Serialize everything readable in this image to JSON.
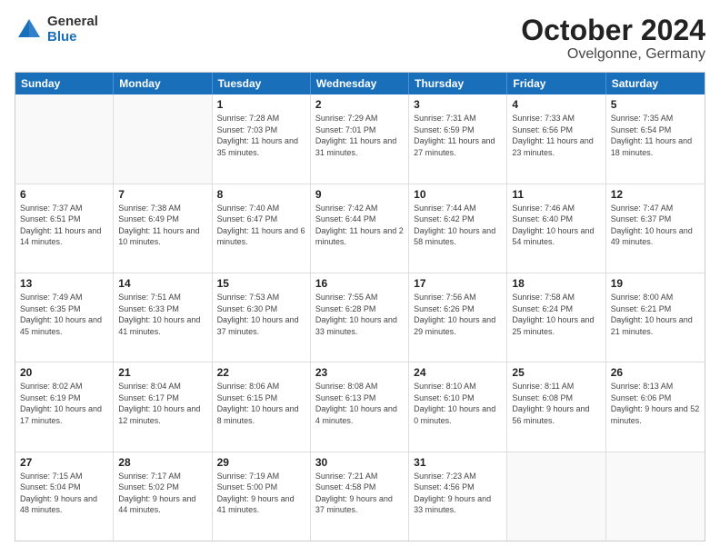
{
  "header": {
    "logo": {
      "general": "General",
      "blue": "Blue"
    },
    "title": "October 2024",
    "location": "Ovelgonne, Germany"
  },
  "weekdays": [
    "Sunday",
    "Monday",
    "Tuesday",
    "Wednesday",
    "Thursday",
    "Friday",
    "Saturday"
  ],
  "weeks": [
    [
      {
        "day": "",
        "sunrise": "",
        "sunset": "",
        "daylight": "",
        "empty": true
      },
      {
        "day": "",
        "sunrise": "",
        "sunset": "",
        "daylight": "",
        "empty": true
      },
      {
        "day": "1",
        "sunrise": "Sunrise: 7:28 AM",
        "sunset": "Sunset: 7:03 PM",
        "daylight": "Daylight: 11 hours and 35 minutes.",
        "empty": false
      },
      {
        "day": "2",
        "sunrise": "Sunrise: 7:29 AM",
        "sunset": "Sunset: 7:01 PM",
        "daylight": "Daylight: 11 hours and 31 minutes.",
        "empty": false
      },
      {
        "day": "3",
        "sunrise": "Sunrise: 7:31 AM",
        "sunset": "Sunset: 6:59 PM",
        "daylight": "Daylight: 11 hours and 27 minutes.",
        "empty": false
      },
      {
        "day": "4",
        "sunrise": "Sunrise: 7:33 AM",
        "sunset": "Sunset: 6:56 PM",
        "daylight": "Daylight: 11 hours and 23 minutes.",
        "empty": false
      },
      {
        "day": "5",
        "sunrise": "Sunrise: 7:35 AM",
        "sunset": "Sunset: 6:54 PM",
        "daylight": "Daylight: 11 hours and 18 minutes.",
        "empty": false
      }
    ],
    [
      {
        "day": "6",
        "sunrise": "Sunrise: 7:37 AM",
        "sunset": "Sunset: 6:51 PM",
        "daylight": "Daylight: 11 hours and 14 minutes.",
        "empty": false
      },
      {
        "day": "7",
        "sunrise": "Sunrise: 7:38 AM",
        "sunset": "Sunset: 6:49 PM",
        "daylight": "Daylight: 11 hours and 10 minutes.",
        "empty": false
      },
      {
        "day": "8",
        "sunrise": "Sunrise: 7:40 AM",
        "sunset": "Sunset: 6:47 PM",
        "daylight": "Daylight: 11 hours and 6 minutes.",
        "empty": false
      },
      {
        "day": "9",
        "sunrise": "Sunrise: 7:42 AM",
        "sunset": "Sunset: 6:44 PM",
        "daylight": "Daylight: 11 hours and 2 minutes.",
        "empty": false
      },
      {
        "day": "10",
        "sunrise": "Sunrise: 7:44 AM",
        "sunset": "Sunset: 6:42 PM",
        "daylight": "Daylight: 10 hours and 58 minutes.",
        "empty": false
      },
      {
        "day": "11",
        "sunrise": "Sunrise: 7:46 AM",
        "sunset": "Sunset: 6:40 PM",
        "daylight": "Daylight: 10 hours and 54 minutes.",
        "empty": false
      },
      {
        "day": "12",
        "sunrise": "Sunrise: 7:47 AM",
        "sunset": "Sunset: 6:37 PM",
        "daylight": "Daylight: 10 hours and 49 minutes.",
        "empty": false
      }
    ],
    [
      {
        "day": "13",
        "sunrise": "Sunrise: 7:49 AM",
        "sunset": "Sunset: 6:35 PM",
        "daylight": "Daylight: 10 hours and 45 minutes.",
        "empty": false
      },
      {
        "day": "14",
        "sunrise": "Sunrise: 7:51 AM",
        "sunset": "Sunset: 6:33 PM",
        "daylight": "Daylight: 10 hours and 41 minutes.",
        "empty": false
      },
      {
        "day": "15",
        "sunrise": "Sunrise: 7:53 AM",
        "sunset": "Sunset: 6:30 PM",
        "daylight": "Daylight: 10 hours and 37 minutes.",
        "empty": false
      },
      {
        "day": "16",
        "sunrise": "Sunrise: 7:55 AM",
        "sunset": "Sunset: 6:28 PM",
        "daylight": "Daylight: 10 hours and 33 minutes.",
        "empty": false
      },
      {
        "day": "17",
        "sunrise": "Sunrise: 7:56 AM",
        "sunset": "Sunset: 6:26 PM",
        "daylight": "Daylight: 10 hours and 29 minutes.",
        "empty": false
      },
      {
        "day": "18",
        "sunrise": "Sunrise: 7:58 AM",
        "sunset": "Sunset: 6:24 PM",
        "daylight": "Daylight: 10 hours and 25 minutes.",
        "empty": false
      },
      {
        "day": "19",
        "sunrise": "Sunrise: 8:00 AM",
        "sunset": "Sunset: 6:21 PM",
        "daylight": "Daylight: 10 hours and 21 minutes.",
        "empty": false
      }
    ],
    [
      {
        "day": "20",
        "sunrise": "Sunrise: 8:02 AM",
        "sunset": "Sunset: 6:19 PM",
        "daylight": "Daylight: 10 hours and 17 minutes.",
        "empty": false
      },
      {
        "day": "21",
        "sunrise": "Sunrise: 8:04 AM",
        "sunset": "Sunset: 6:17 PM",
        "daylight": "Daylight: 10 hours and 12 minutes.",
        "empty": false
      },
      {
        "day": "22",
        "sunrise": "Sunrise: 8:06 AM",
        "sunset": "Sunset: 6:15 PM",
        "daylight": "Daylight: 10 hours and 8 minutes.",
        "empty": false
      },
      {
        "day": "23",
        "sunrise": "Sunrise: 8:08 AM",
        "sunset": "Sunset: 6:13 PM",
        "daylight": "Daylight: 10 hours and 4 minutes.",
        "empty": false
      },
      {
        "day": "24",
        "sunrise": "Sunrise: 8:10 AM",
        "sunset": "Sunset: 6:10 PM",
        "daylight": "Daylight: 10 hours and 0 minutes.",
        "empty": false
      },
      {
        "day": "25",
        "sunrise": "Sunrise: 8:11 AM",
        "sunset": "Sunset: 6:08 PM",
        "daylight": "Daylight: 9 hours and 56 minutes.",
        "empty": false
      },
      {
        "day": "26",
        "sunrise": "Sunrise: 8:13 AM",
        "sunset": "Sunset: 6:06 PM",
        "daylight": "Daylight: 9 hours and 52 minutes.",
        "empty": false
      }
    ],
    [
      {
        "day": "27",
        "sunrise": "Sunrise: 7:15 AM",
        "sunset": "Sunset: 5:04 PM",
        "daylight": "Daylight: 9 hours and 48 minutes.",
        "empty": false
      },
      {
        "day": "28",
        "sunrise": "Sunrise: 7:17 AM",
        "sunset": "Sunset: 5:02 PM",
        "daylight": "Daylight: 9 hours and 44 minutes.",
        "empty": false
      },
      {
        "day": "29",
        "sunrise": "Sunrise: 7:19 AM",
        "sunset": "Sunset: 5:00 PM",
        "daylight": "Daylight: 9 hours and 41 minutes.",
        "empty": false
      },
      {
        "day": "30",
        "sunrise": "Sunrise: 7:21 AM",
        "sunset": "Sunset: 4:58 PM",
        "daylight": "Daylight: 9 hours and 37 minutes.",
        "empty": false
      },
      {
        "day": "31",
        "sunrise": "Sunrise: 7:23 AM",
        "sunset": "Sunset: 4:56 PM",
        "daylight": "Daylight: 9 hours and 33 minutes.",
        "empty": false
      },
      {
        "day": "",
        "sunrise": "",
        "sunset": "",
        "daylight": "",
        "empty": true
      },
      {
        "day": "",
        "sunrise": "",
        "sunset": "",
        "daylight": "",
        "empty": true
      }
    ]
  ]
}
